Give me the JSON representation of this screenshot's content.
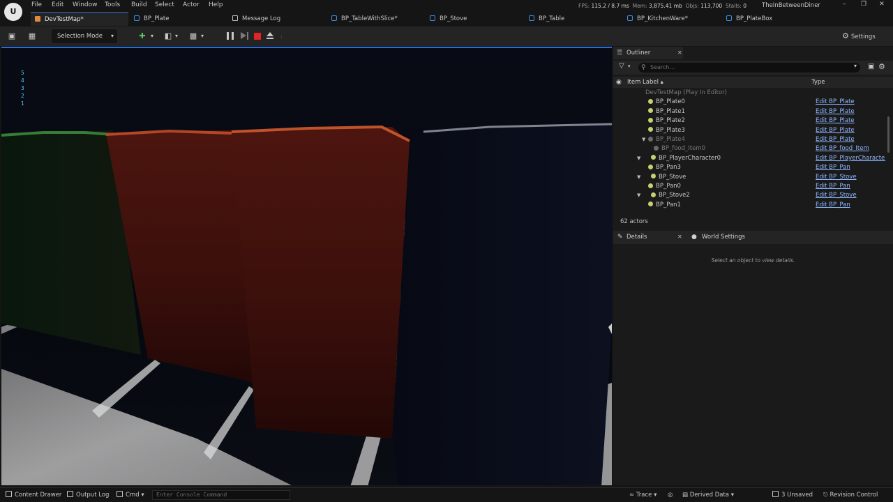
{
  "menu": [
    "File",
    "Edit",
    "Window",
    "Tools",
    "Build",
    "Select",
    "Actor",
    "Help"
  ],
  "logo_letter": "U",
  "stats": {
    "fps_label": "FPS:",
    "fps_value": "115.2",
    "ms_value": "/ 8.7 ms",
    "mem_label": "Mem:",
    "mem_value": "3,875.41 mb",
    "objs_label": "Objs:",
    "objs_value": "113,700",
    "stalls_label": "Stalls:",
    "stalls_value": "0"
  },
  "project_name": "TheInBetweenDiner",
  "window_buttons": {
    "minimize": "–",
    "restore": "❐",
    "close": "✕"
  },
  "tabs": [
    {
      "label": "DevTestMap*",
      "icon": "map-icon",
      "active": true
    },
    {
      "label": "BP_Plate",
      "icon": "blueprint-icon"
    },
    {
      "label": "Message Log",
      "icon": "log-icon"
    },
    {
      "label": "BP_TableWithSlice*",
      "icon": "blueprint-icon"
    },
    {
      "label": "BP_Stove",
      "icon": "blueprint-icon"
    },
    {
      "label": "BP_Table",
      "icon": "blueprint-icon"
    },
    {
      "label": "BP_KitchenWare*",
      "icon": "blueprint-icon"
    },
    {
      "label": "BP_PlateBox",
      "icon": "blueprint-icon"
    }
  ],
  "tab_close": "✕",
  "toolbar": {
    "selection_mode": "Selection Mode",
    "settings": "Settings",
    "chevron": "▾"
  },
  "viewport": {
    "debug_numbers": [
      "5",
      "4",
      "3",
      "2",
      "1"
    ],
    "debug_color": "#4fd0ff"
  },
  "outliner": {
    "title": "Outliner",
    "search_placeholder": "Search...",
    "col_label": "Item Label ▴",
    "col_type": "Type",
    "rows": [
      {
        "label": "DevTestMap (Play In Editor)",
        "type": "",
        "indent": 0,
        "dim": true,
        "arrow": ""
      },
      {
        "label": "BP_Plate0",
        "type": "Edit BP_Plate",
        "indent": 2,
        "dim": false,
        "arrow": ""
      },
      {
        "label": "BP_Plate1",
        "type": "Edit BP_Plate",
        "indent": 2,
        "dim": false,
        "arrow": ""
      },
      {
        "label": "BP_Plate2",
        "type": "Edit BP_Plate",
        "indent": 2,
        "dim": false,
        "arrow": ""
      },
      {
        "label": "BP_Plate3",
        "type": "Edit BP_Plate",
        "indent": 2,
        "dim": false,
        "arrow": ""
      },
      {
        "label": "BP_Plate4",
        "type": "Edit BP_Plate",
        "indent": 2,
        "dim": true,
        "arrow": "▼"
      },
      {
        "label": "BP_food_Item0",
        "type": "Edit BP_food_Item",
        "indent": 3,
        "dim": true,
        "arrow": ""
      },
      {
        "label": "BP_PlayerCharacter0",
        "type": "Edit BP_PlayerCharacter",
        "indent": 1,
        "dim": false,
        "arrow": "▼"
      },
      {
        "label": "BP_Pan3",
        "type": "Edit BP_Pan",
        "indent": 2,
        "dim": false,
        "arrow": ""
      },
      {
        "label": "BP_Stove",
        "type": "Edit BP_Stove",
        "indent": 1,
        "dim": false,
        "arrow": "▼"
      },
      {
        "label": "BP_Pan0",
        "type": "Edit BP_Pan",
        "indent": 2,
        "dim": false,
        "arrow": ""
      },
      {
        "label": "BP_Stove2",
        "type": "Edit BP_Stove",
        "indent": 1,
        "dim": false,
        "arrow": "▼"
      },
      {
        "label": "BP_Pan1",
        "type": "Edit BP_Pan",
        "indent": 2,
        "dim": false,
        "arrow": ""
      }
    ],
    "actor_count": "62 actors",
    "close": "✕"
  },
  "details": {
    "title": "Details",
    "world_settings": "World Settings",
    "empty_message": "Select an object to view details."
  },
  "statusbar": {
    "content_drawer": "Content Drawer",
    "output_log": "Output Log",
    "cmd": "Cmd",
    "console_placeholder": "Enter Console Command",
    "trace": "Trace",
    "derived_data": "Derived Data",
    "unsaved": "3 Unsaved",
    "revision_control": "Revision Control"
  }
}
